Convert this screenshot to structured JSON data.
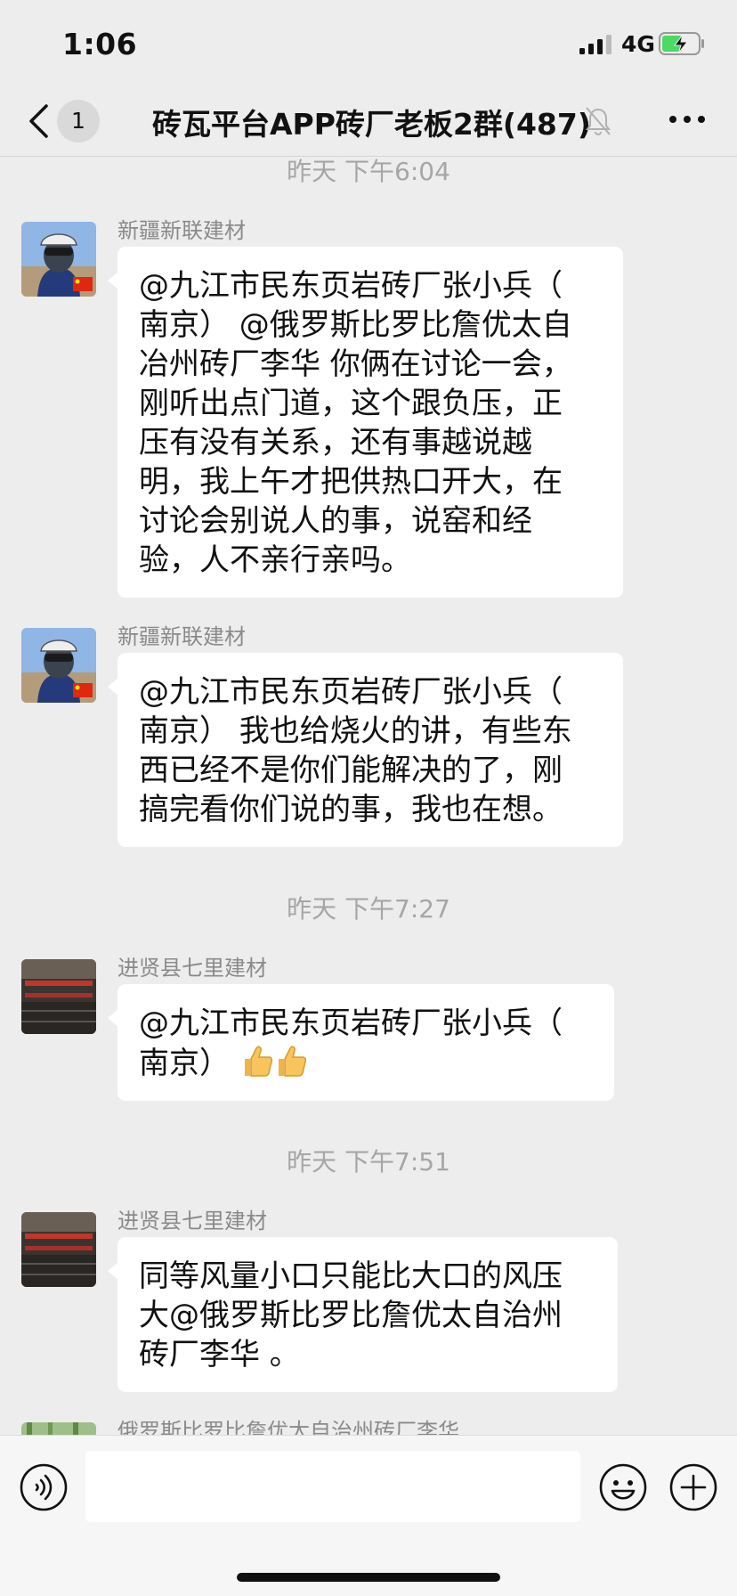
{
  "status_bar": {
    "time": "1:06",
    "network": "4G",
    "signal_icon": "cellular-signal",
    "battery_icon": "battery-charging"
  },
  "header": {
    "back_icon": "chevron-left",
    "unread_count": "1",
    "title": "砖瓦平台APP砖厂老板2群(487)",
    "mute_icon": "bell-slash",
    "more_icon": "ellipsis-horizontal"
  },
  "timestamps": [
    "昨天 下午6:04",
    "昨天 下午7:27",
    "昨天 下午7:51"
  ],
  "messages": [
    {
      "sender": "新疆新联建材",
      "lines": [
        "@九江市民东页岩砖厂张小兵（",
        "南京） @俄罗斯比罗比詹优太自",
        "冶州砖厂李华 你俩在讨论一会，",
        "刚听出点门道，这个跟负压，正",
        "压有没有关系，还有事越说越",
        "明，我上午才把供热口开大，在",
        "讨论会别说人的事，说窑和经",
        "验，人不亲行亲吗。"
      ]
    },
    {
      "sender": "新疆新联建材",
      "lines": [
        "@九江市民东页岩砖厂张小兵（",
        "南京） 我也给烧火的讲，有些东",
        "西已经不是你们能解决的了，刚",
        "搞完看你们说的事，我也在想。"
      ]
    },
    {
      "sender": "进贤县七里建材",
      "lines": [
        "@九江市民东页岩砖厂张小兵（",
        "南京） "
      ],
      "emoji": "thumbs-up x2"
    },
    {
      "sender": "进贤县七里建材",
      "lines": [
        "同等风量小口只能比大口的风压",
        "大@俄罗斯比罗比詹优太自治州",
        "砖厂李华 。"
      ]
    },
    {
      "sender": "俄罗斯比罗比詹优太自治州砖厂李华"
    }
  ],
  "input_bar": {
    "voice_icon": "voice-wave",
    "input_value": "",
    "emoji_icon": "smiley-face",
    "plus_icon": "plus-circle"
  },
  "colors": {
    "background": "#ededed",
    "bubble": "#ffffff",
    "timestamp": "#a6a6a6",
    "sender_name": "#8a8a8a",
    "battery_green": "#4cd964",
    "flag_red": "#de2910"
  }
}
